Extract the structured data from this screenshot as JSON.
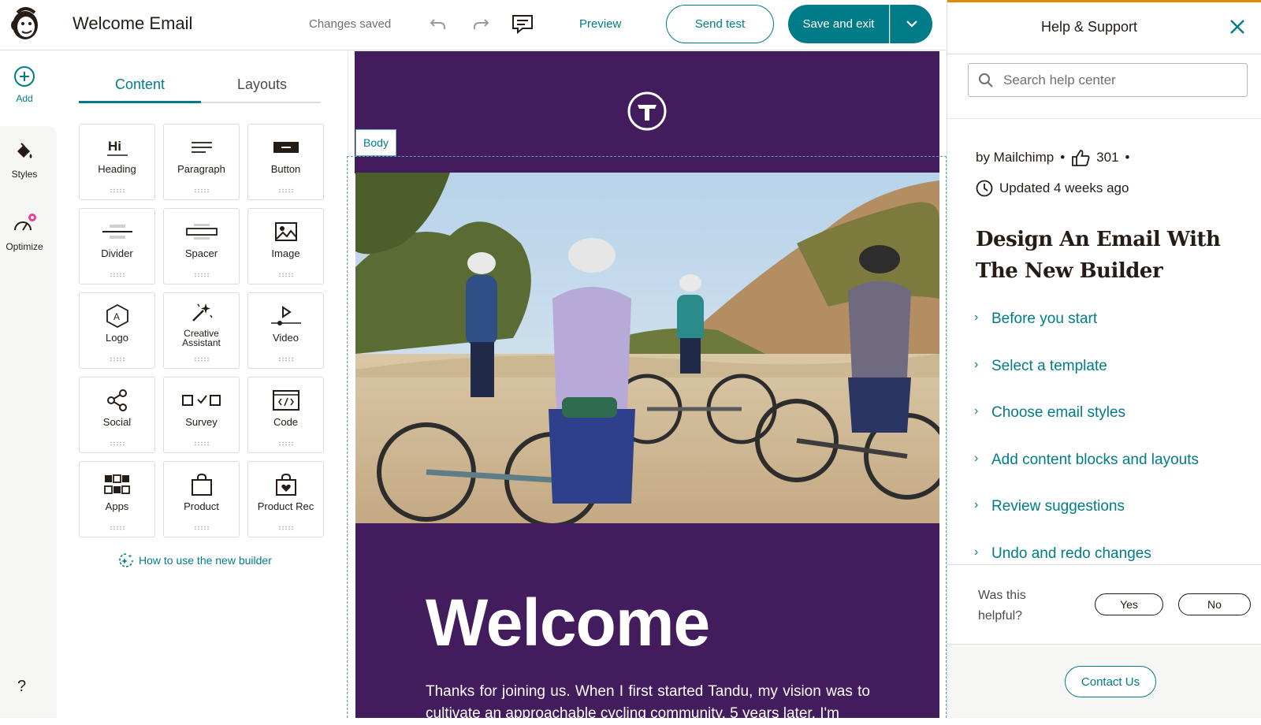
{
  "header": {
    "doc_title": "Welcome Email",
    "status": "Changes saved",
    "preview_label": "Preview",
    "send_test_label": "Send test",
    "save_exit_label": "Save and exit"
  },
  "rail": {
    "add_label": "Add",
    "styles_label": "Styles",
    "optimize_label": "Optimize",
    "help_label": "?"
  },
  "panel": {
    "tabs": [
      {
        "label": "Content",
        "active": true
      },
      {
        "label": "Layouts",
        "active": false
      }
    ],
    "blocks": [
      {
        "label": "Heading",
        "icon": "heading-icon"
      },
      {
        "label": "Paragraph",
        "icon": "paragraph-icon"
      },
      {
        "label": "Button",
        "icon": "button-icon"
      },
      {
        "label": "Divider",
        "icon": "divider-icon"
      },
      {
        "label": "Spacer",
        "icon": "spacer-icon"
      },
      {
        "label": "Image",
        "icon": "image-icon"
      },
      {
        "label": "Logo",
        "icon": "logo-icon"
      },
      {
        "label": "Creative Assistant",
        "icon": "creative-assistant-icon"
      },
      {
        "label": "Video",
        "icon": "video-icon"
      },
      {
        "label": "Social",
        "icon": "social-icon"
      },
      {
        "label": "Survey",
        "icon": "survey-icon"
      },
      {
        "label": "Code",
        "icon": "code-icon"
      },
      {
        "label": "Apps",
        "icon": "apps-icon"
      },
      {
        "label": "Product",
        "icon": "product-icon"
      },
      {
        "label": "Product Rec",
        "icon": "product-rec-icon"
      }
    ],
    "heading_icon_text": "Hi",
    "logo_icon_text": "A",
    "howto_label": "How to use the new builder"
  },
  "email": {
    "body_tag": "Body",
    "headline": "Welcome",
    "body_text": "Thanks for joining us. When I first started Tandu, my vision was to cultivate an approachable cycling community. 5 years later, I'm"
  },
  "help": {
    "title": "Help & Support",
    "search_placeholder": "Search help center",
    "author": "by Mailchimp",
    "likes": "301",
    "updated": "Updated 4 weeks ago",
    "article_title": "Design An Email With The New Builder",
    "toc": [
      "Before you start",
      "Select a template",
      "Choose email styles",
      "Add content blocks and layouts",
      "Review suggestions",
      "Undo and redo changes"
    ],
    "feedback_question": "Was this helpful?",
    "yes_label": "Yes",
    "no_label": "No",
    "contact_label": "Contact Us"
  },
  "colors": {
    "accent": "#007c89",
    "email_bg": "#421c5c",
    "help_accent": "#e08a00"
  }
}
